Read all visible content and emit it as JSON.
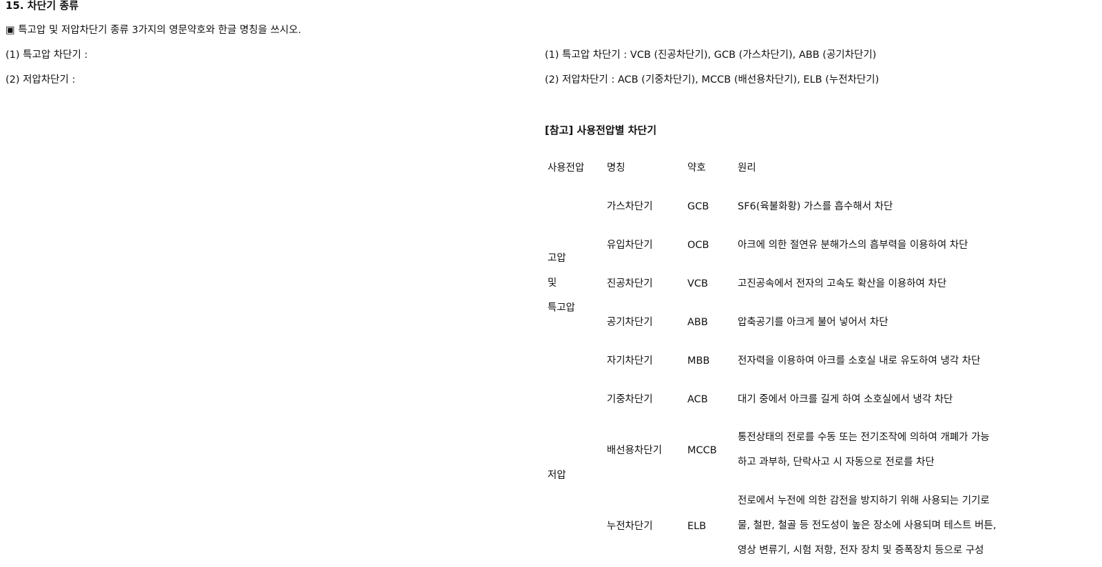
{
  "doc": {
    "title": "15. 차단기 종류",
    "question": "▣ 특고압 및 저압차단기 종류 3가지의 영문약호와 한글 명칭을 쓰시오.",
    "q1": "(1) 특고압 차단기 :",
    "q2": "(2) 저압차단기 :",
    "a1": "(1) 특고압 차단기 : VCB (진공차단기), GCB (가스차단기), ABB (공기차단기)",
    "a2": "(2) 저압차단기 : ACB (기중차단기), MCCB (배선용차단기), ELB (누전차단기)",
    "ref_title": "[참고] 사용전압별 차단기"
  },
  "table": {
    "headers": [
      "사용전압",
      "명칭",
      "약호",
      "원리"
    ],
    "groups": {
      "high_line1": "고압",
      "high_line2": "및",
      "high_line3": "특고압",
      "low": "저압"
    },
    "rows": [
      {
        "name": "가스차단기",
        "abbr": "GCB",
        "principle": [
          "SF6(육불화황) 가스를 흡수해서 차단"
        ]
      },
      {
        "name": "유입차단기",
        "abbr": "OCB",
        "principle": [
          "아크에 의한 절연유 분해가스의 흡부력을 이용하여 차단"
        ]
      },
      {
        "name": "진공차단기",
        "abbr": "VCB",
        "principle": [
          "고진공속에서 전자의 고속도 확산을 이용하여 차단"
        ]
      },
      {
        "name": "공기차단기",
        "abbr": "ABB",
        "principle": [
          "압축공기를 아크게 불어 넣어서 차단"
        ]
      },
      {
        "name": "자기차단기",
        "abbr": "MBB",
        "principle": [
          "전자력을 이용하여 아크를 소호실 내로 유도하여 냉각 차단"
        ]
      },
      {
        "name": "기중차단기",
        "abbr": "ACB",
        "principle": [
          "대기 중에서 아크를 길게 하여 소호실에서 냉각 차단"
        ]
      },
      {
        "name": "배선용차단기",
        "abbr": "MCCB",
        "principle": [
          "통전상태의 전로를 수동 또는 전기조작에 의하여 개폐가 가능",
          "하고 과부하, 단락사고 시 자동으로 전로를 차단"
        ]
      },
      {
        "name": "누전차단기",
        "abbr": "ELB",
        "principle": [
          "전로에서 누전에 의한 감전을 방지하기 위해 사용되는 기기로",
          "물, 철판, 철골 등 전도성이 높은 장소에 사용되며 테스트 버튼,",
          "영상 변류기, 시험 저항, 전자 장치 및 증폭장치 등으로 구성"
        ]
      }
    ]
  }
}
